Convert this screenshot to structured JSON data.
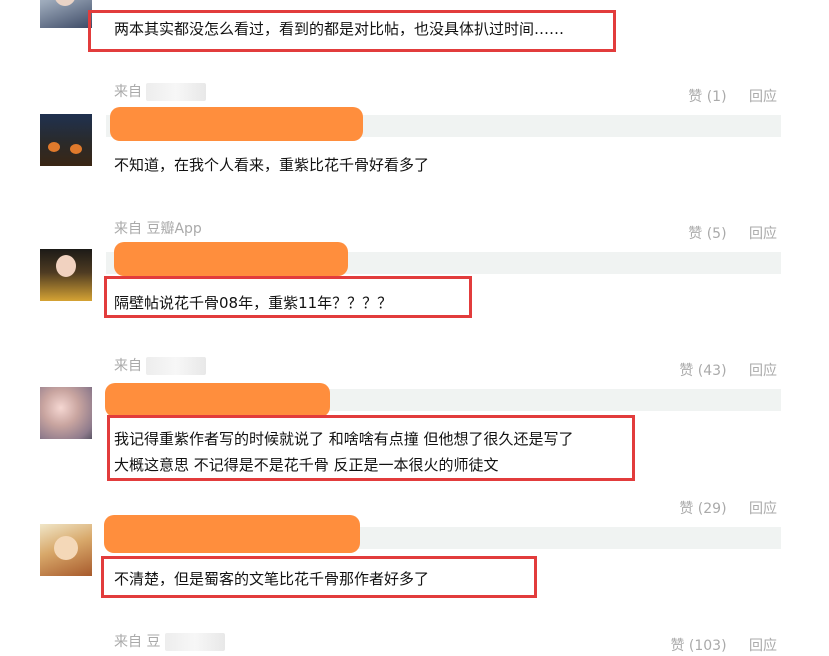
{
  "comments": [
    {
      "text": "两本其实都没怎么看过，看到的都是对比帖，也没具体扒过时间……"
    },
    {
      "source": "来自",
      "likes": "赞 (1)",
      "reply": "回应",
      "text": "不知道，在我个人看来，重紫比花千骨好看多了"
    },
    {
      "source": "来自 豆瓣App",
      "likes": "赞 (5)",
      "reply": "回应",
      "text": "隔壁帖说花千骨08年，重紫11年？？？？"
    },
    {
      "source": "来自",
      "likes": "赞 (43)",
      "reply": "回应",
      "text_lines": [
        "我记得重紫作者写的时候就说了 和啥啥有点撞 但他想了很久还是写了",
        "大概这意思 不记得是不是花千骨 反正是一本很火的师徒文"
      ]
    },
    {
      "likes": "赞 (29)",
      "reply": "回应",
      "text": "不清楚，但是蜀客的文笔比花千骨那作者好多了"
    },
    {
      "source": "来自 豆",
      "likes": "赞 (103)",
      "reply": "回应"
    }
  ],
  "colors": {
    "highlight_box": "#e23c3c",
    "redaction": "#ff8e3d",
    "quote_band": "#f0f3f2",
    "meta_text": "#aaaaaa"
  }
}
